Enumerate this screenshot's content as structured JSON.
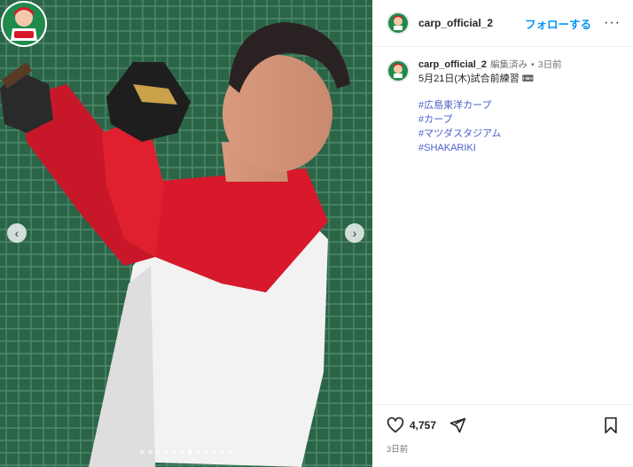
{
  "media": {
    "slide_count": 12,
    "active_slide": 6,
    "nav_prev_glyph": "‹",
    "nav_next_glyph": "›"
  },
  "header": {
    "username": "carp_official_2",
    "follow_label": "フォローする",
    "more_glyph": "···"
  },
  "caption": {
    "username": "carp_official_2",
    "edited_label": "編集済み",
    "separator": "•",
    "time": "3日前",
    "text": "5月21日(木)試合前練習 📼",
    "hashtags": [
      "#広島東洋カープ",
      "#カープ",
      "#マツダスタジアム",
      "#SHAKARIKI"
    ]
  },
  "actions": {
    "like_count": "4,757",
    "time_ago": "3日前"
  },
  "colors": {
    "follow_blue": "#0095f6",
    "hashtag_blue": "#4a61c8",
    "carp_red": "#d7192b",
    "net_green": "#2f6a4c"
  },
  "icons": [
    "heart-icon",
    "share-icon",
    "bookmark-icon",
    "more-icon",
    "chevron-left-icon",
    "chevron-right-icon"
  ]
}
